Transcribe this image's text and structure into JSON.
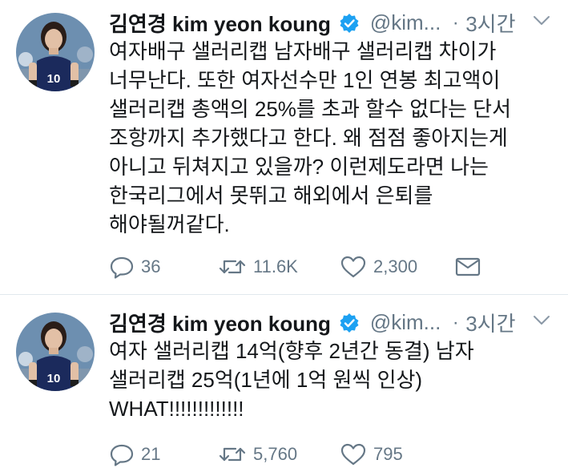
{
  "tweets": [
    {
      "name": "김연경 kim yeon koung",
      "handle": "@kim...",
      "dot": "·",
      "time": "3시간",
      "text": "여자배구 샐러리캡 남자배구 샐러리캡 차이가\n너무난다. 또한 여자선수만 1인 연봉 최고액이\n샐러리캡 총액의 25%를 초과 할수 없다는 단서\n조항까지 추가했다고 한다. 왜 점점 좋아지는게\n아니고 뒤쳐지고 있을까? 이런제도라면 나는\n한국리그에서 못뛰고 해외에서 은퇴를\n해야될꺼같다.",
      "replies": "36",
      "retweets": "11.6K",
      "likes": "2,300"
    },
    {
      "name": "김연경 kim yeon koung",
      "handle": "@kim...",
      "dot": "·",
      "time": "3시간",
      "text": "여자 샐러리캡 14억(향후 2년간 동결) 남자\n샐러리캡 25억(1년에 1억 원씩 인상)\nWHAT!!!!!!!!!!!!!",
      "replies": "21",
      "retweets": "5,760",
      "likes": "795"
    }
  ],
  "icons": {
    "verified": "verified-badge-icon",
    "caret": "chevron-down-icon",
    "reply": "reply-icon",
    "retweet": "retweet-icon",
    "like": "heart-icon",
    "dm": "envelope-icon"
  },
  "colors": {
    "verified": "#1da1f2",
    "secondary_text": "#657786",
    "icon": "#657786",
    "jersey": "#1b2a5c",
    "jersey_number": "#ffffff"
  },
  "avatar": {
    "jersey_number": "10"
  }
}
